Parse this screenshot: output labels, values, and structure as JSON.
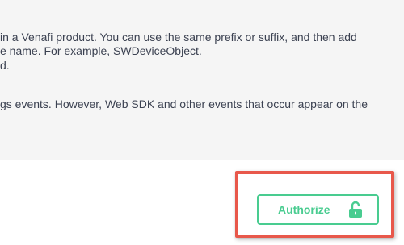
{
  "description": {
    "lines": [
      "in a Venafi product. You can use the same prefix or suffix, and then add",
      "e name. For example, SWDeviceObject.",
      "d.",
      "gs events. However, Web SDK and other events that occur appear on the",
      ""
    ]
  },
  "authorize": {
    "label": "Authorize",
    "icon": "unlocked-padlock-icon",
    "accent_color": "#49cc90"
  },
  "highlight": {
    "color": "#e8584b"
  }
}
